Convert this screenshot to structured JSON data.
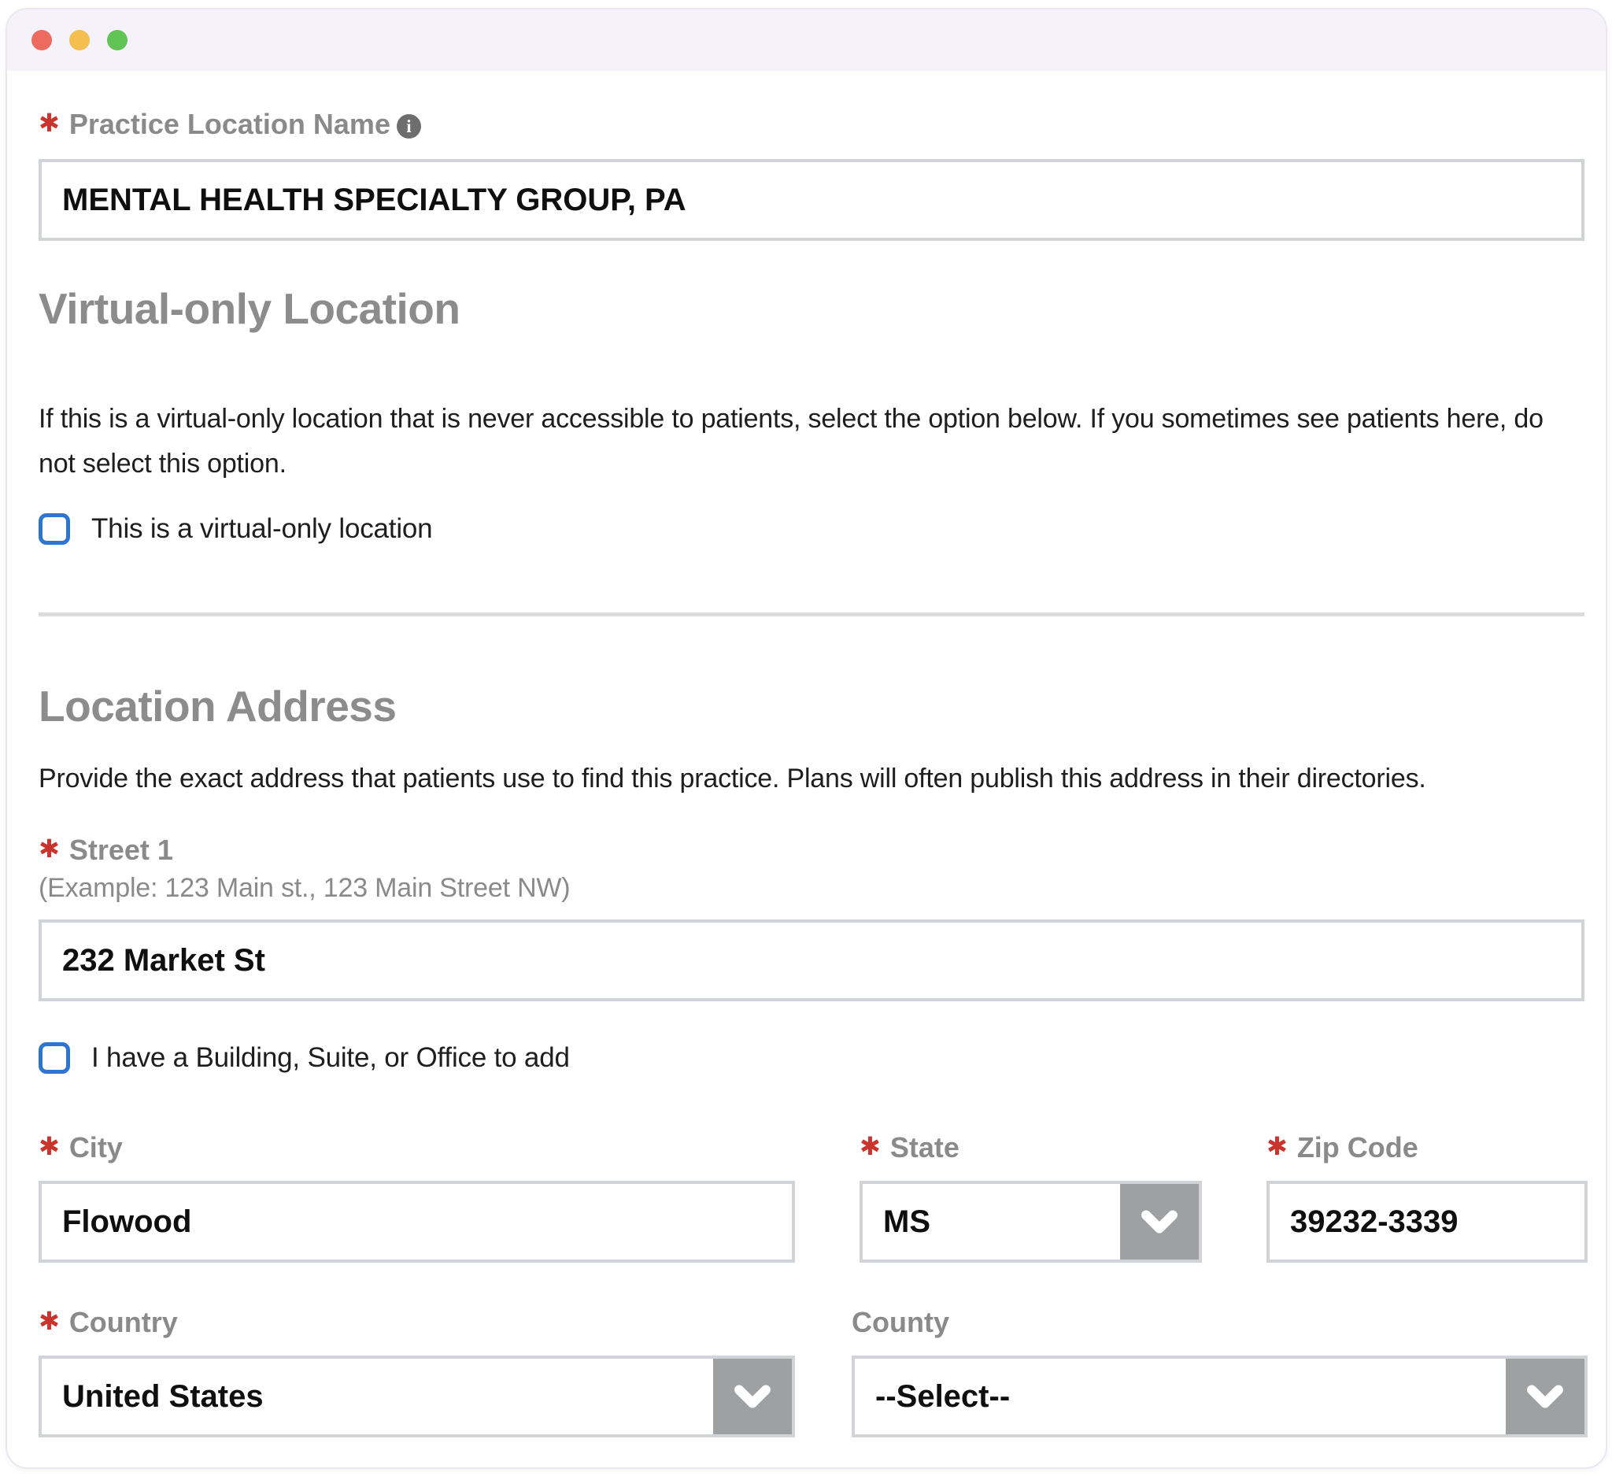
{
  "window": {
    "buttons": [
      "close",
      "minimize",
      "maximize"
    ]
  },
  "icons": {
    "info": "i"
  },
  "required_marker": "✱",
  "colors": {
    "required_red": "#c9342c",
    "checkbox_blue": "#2e74d1",
    "chevron_gray": "#9fa0a2",
    "label_gray": "#8a8a8a",
    "heading_gray": "#8c8c8c",
    "titlebar_background": "#f5f3f9",
    "traffic_red": "#ec6a5e",
    "traffic_yellow": "#f4bf4f",
    "traffic_green": "#61c454"
  },
  "form": {
    "practice_name": {
      "label": "Practice Location Name",
      "value": "MENTAL HEALTH SPECIALTY GROUP, PA"
    },
    "virtual": {
      "heading": "Virtual-only Location",
      "description": "If this is a virtual-only location that is never accessible to patients, select the option below. If you sometimes see patients here, do not select this option.",
      "checkbox_label": "This is a virtual-only location"
    },
    "address": {
      "heading": "Location Address",
      "description": "Provide the exact address that patients use to find this practice. Plans will often publish this address in their directories.",
      "street1": {
        "label": "Street 1",
        "example": "(Example: 123 Main st., 123 Main Street NW)",
        "value": "232 Market St"
      },
      "building_checkbox_label": "I have a Building, Suite, or Office to add",
      "city": {
        "label": "City",
        "value": "Flowood"
      },
      "state": {
        "label": "State",
        "value": "MS"
      },
      "zip": {
        "label": "Zip Code",
        "value": "39232-3339"
      },
      "country": {
        "label": "Country",
        "value": "United States"
      },
      "county": {
        "label": "County",
        "value": "--Select--"
      }
    }
  }
}
